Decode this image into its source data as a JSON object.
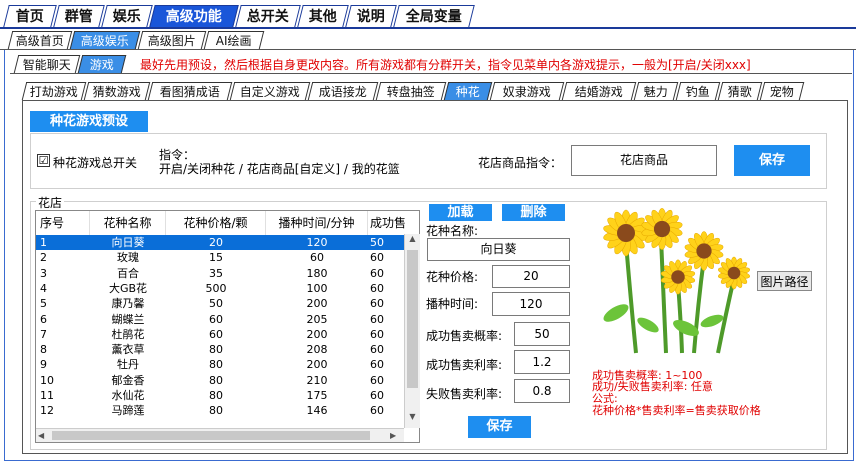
{
  "main_tabs": [
    "首页",
    "群管",
    "娱乐",
    "高级功能",
    "总开关",
    "其他",
    "说明",
    "全局变量"
  ],
  "sub_tabs": [
    "高级首页",
    "高级娱乐",
    "高级图片",
    "AI绘画"
  ],
  "section_tabs": [
    "智能聊天",
    "游戏"
  ],
  "notice": "最好先用预设，然后根据自身更改内容。所有游戏都有分群开关，指令见菜单内各游戏提示，一般为[开启/关闭xxx]",
  "game_tabs": [
    "打劫游戏",
    "猜数游戏",
    "看图猜成语",
    "自定义游戏",
    "成语接龙",
    "转盘抽签",
    "种花",
    "奴隶游戏",
    "结婚游戏",
    "魅力",
    "钓鱼",
    "猜歌",
    "宠物"
  ],
  "preset_button": "种花游戏预设",
  "master_switch": {
    "label": "种花游戏总开关",
    "checked": "☑"
  },
  "command": {
    "title": "指令：",
    "text": "开启/关闭种花 / 花店商品[自定义] / 我的花篮"
  },
  "shop_cmd": {
    "label": "花店商品指令：",
    "value": "花店商品"
  },
  "save_button": "保存",
  "shop": {
    "title": "花店",
    "columns": [
      "序号",
      "花种名称",
      "花种价格/颗",
      "播种时间/分钟",
      "成功售"
    ],
    "rows": [
      [
        "1",
        "向日葵",
        "20",
        "120",
        "50"
      ],
      [
        "2",
        "玫瑰",
        "15",
        "60",
        "60"
      ],
      [
        "3",
        "百合",
        "35",
        "180",
        "60"
      ],
      [
        "4",
        "大GB花",
        "500",
        "100",
        "60"
      ],
      [
        "5",
        "康乃馨",
        "50",
        "200",
        "60"
      ],
      [
        "6",
        "蝴蝶兰",
        "60",
        "205",
        "60"
      ],
      [
        "7",
        "杜鹃花",
        "60",
        "200",
        "60"
      ],
      [
        "8",
        "薰衣草",
        "80",
        "208",
        "60"
      ],
      [
        "9",
        "牡丹",
        "80",
        "200",
        "60"
      ],
      [
        "10",
        "郁金香",
        "80",
        "210",
        "60"
      ],
      [
        "11",
        "水仙花",
        "80",
        "175",
        "60"
      ],
      [
        "12",
        "马蹄莲",
        "80",
        "146",
        "60"
      ]
    ]
  },
  "load_button": "加载",
  "delete_button": "删除",
  "form": {
    "name_label": "花种名称:",
    "name_value": "向日葵",
    "price_label": "花种价格:",
    "price_value": "20",
    "time_label": "播种时间:",
    "time_value": "120",
    "succ_rate_label": "成功售卖概率:",
    "succ_rate_value": "50",
    "succ_profit_label": "成功售卖利率:",
    "succ_profit_value": "1.2",
    "fail_profit_label": "失败售卖利率:",
    "fail_profit_value": "0.8"
  },
  "form_save": "保存",
  "image_path_button": "图片路径",
  "hints": [
    "成功售卖概率: 1~100",
    "成功/失败售卖利率: 任意",
    "公式:",
    "花种价格*售卖利率=售卖获取价格"
  ],
  "colors": {
    "accent": "#1e8ef0",
    "active_tab": "#1a56d9",
    "notice": "#e00000",
    "selected_row": "#0a6ed8"
  }
}
